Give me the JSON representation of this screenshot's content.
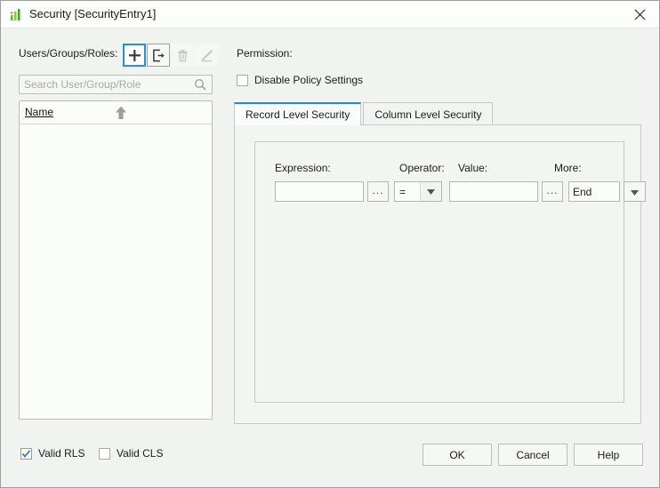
{
  "window": {
    "title": "Security [SecurityEntry1]",
    "icon": "bar-chart-icon",
    "close_label": "×"
  },
  "left": {
    "users_label": "Users/Groups/Roles:",
    "toolbar": [
      {
        "name": "add-user-button",
        "icon": "plus-icon",
        "enabled": true,
        "focused": true
      },
      {
        "name": "import-user-button",
        "icon": "export-arrow-icon",
        "enabled": true,
        "focused": false
      },
      {
        "name": "delete-user-button",
        "icon": "trash-icon",
        "enabled": false,
        "focused": false
      },
      {
        "name": "edit-user-button",
        "icon": "pencil-icon",
        "enabled": false,
        "focused": false
      }
    ],
    "search": {
      "value": "",
      "placeholder": "Search User/Group/Role",
      "icon": "search-icon"
    },
    "list": {
      "column_header": "Name",
      "sort_direction": "ascending",
      "sort_icon": "arrow-up-icon",
      "rows": []
    }
  },
  "right": {
    "permission_label": "Permission:",
    "disable_policy": {
      "label": "Disable Policy Settings",
      "checked": false
    },
    "tabs": [
      {
        "label": "Record Level Security",
        "active": true
      },
      {
        "label": "Column Level Security",
        "active": false
      }
    ],
    "expression_row": {
      "expression_label": "Expression:",
      "expression_value": "",
      "expression_browse": "...",
      "operator_label": "Operator:",
      "operator_value": "=",
      "value_label": "Value:",
      "value_value": "",
      "value_browse": "...",
      "more_label": "More:",
      "more_value": "End"
    }
  },
  "footer": {
    "valid_rls": {
      "label": "Valid RLS",
      "checked": true
    },
    "valid_cls": {
      "label": "Valid CLS",
      "checked": false
    },
    "ok_label": "OK",
    "cancel_label": "Cancel",
    "help_label": "Help"
  },
  "colors": {
    "accent": "#1e8bd2",
    "focus": "#2a8fd4",
    "check": "#2a7fd0",
    "window_bg": "#f1f3f1",
    "titlebar_bg": "#fcfefc",
    "field_bg": "#fbfdfb",
    "border": "#bcbebc"
  }
}
